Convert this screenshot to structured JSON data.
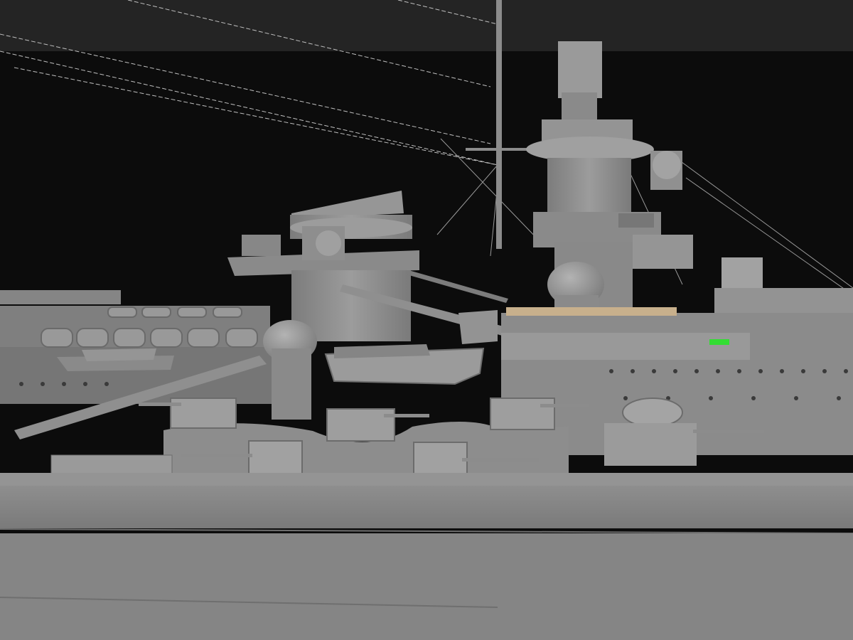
{
  "scene": {
    "subject": "battleship-3d-model-render",
    "palette": {
      "sky_top": "#232323",
      "sky": "#0c0c0c",
      "hull": "#8a8a8a",
      "hull_dark": "#6f6f6f",
      "superstructure": "#8d8d8d",
      "superstructure_light": "#a3a3a3",
      "shadow": "#5a5a5a",
      "deck_wood": "#c8b08c",
      "rigging": "#bdbdbd",
      "marker_green": "#33dd33"
    }
  }
}
